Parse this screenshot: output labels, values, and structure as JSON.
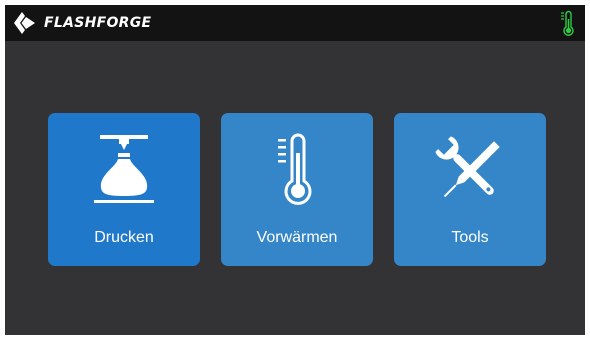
{
  "header": {
    "brand": "FLASHFORGE",
    "logo_icon": "flashforge-logo-icon",
    "status_icon": "thermometer-icon",
    "status_color": "#2ecc40"
  },
  "menu": {
    "tiles": [
      {
        "label": "Drucken",
        "icon": "print-icon",
        "color": "#1f78c9",
        "selected": true
      },
      {
        "label": "Vorwärmen",
        "icon": "thermometer-icon",
        "color": "#3486c9",
        "selected": false
      },
      {
        "label": "Tools",
        "icon": "tools-icon",
        "color": "#3486c9",
        "selected": false
      }
    ]
  },
  "colors": {
    "background": "#333335",
    "topbar": "#131313",
    "text": "#ffffff"
  }
}
